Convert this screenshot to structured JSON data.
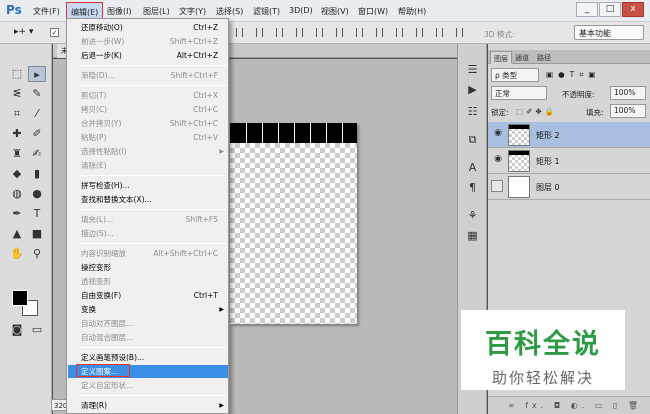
{
  "app": {
    "logo": "Ps",
    "menus": [
      "文件(F)",
      "编辑(E)",
      "图像(I)",
      "图层(L)",
      "文字(Y)",
      "选择(S)",
      "滤镜(T)",
      "3D(D)",
      "视图(V)",
      "窗口(W)",
      "帮助(H)"
    ],
    "window_buttons": [
      "_",
      "□",
      "x"
    ]
  },
  "options_bar": {
    "mode_3d_label": "3D 模式:",
    "workspace": "基本功能"
  },
  "document": {
    "tab_label": "未",
    "zoom": "320"
  },
  "edit_menu": {
    "items": [
      {
        "label": "还原移动(O)",
        "shortcut": "Ctrl+Z",
        "disabled": false
      },
      {
        "label": "前进一步(W)",
        "shortcut": "Shift+Ctrl+Z",
        "disabled": true
      },
      {
        "label": "后退一步(K)",
        "shortcut": "Alt+Ctrl+Z",
        "disabled": false
      },
      {
        "label": "渐隐(D)...",
        "shortcut": "Shift+Ctrl+F",
        "disabled": true
      },
      {
        "label": "剪切(T)",
        "shortcut": "Ctrl+X",
        "disabled": true
      },
      {
        "label": "拷贝(C)",
        "shortcut": "Ctrl+C",
        "disabled": true
      },
      {
        "label": "合并拷贝(Y)",
        "shortcut": "Shift+Ctrl+C",
        "disabled": true
      },
      {
        "label": "粘贴(P)",
        "shortcut": "Ctrl+V",
        "disabled": true
      },
      {
        "label": "选择性粘贴(I)",
        "shortcut": "",
        "disabled": true,
        "submenu": true
      },
      {
        "label": "清除(E)",
        "shortcut": "",
        "disabled": true
      },
      {
        "label": "拼写检查(H)...",
        "shortcut": "",
        "disabled": false
      },
      {
        "label": "查找和替换文本(X)...",
        "shortcut": "",
        "disabled": false
      },
      {
        "label": "填充(L)...",
        "shortcut": "Shift+F5",
        "disabled": true
      },
      {
        "label": "描边(S)...",
        "shortcut": "",
        "disabled": true
      },
      {
        "label": "内容识别缩放",
        "shortcut": "Alt+Shift+Ctrl+C",
        "disabled": true
      },
      {
        "label": "操控变形",
        "shortcut": "",
        "disabled": false
      },
      {
        "label": "透视变形",
        "shortcut": "",
        "disabled": true
      },
      {
        "label": "自由变换(F)",
        "shortcut": "Ctrl+T",
        "disabled": false
      },
      {
        "label": "变换",
        "shortcut": "",
        "disabled": false,
        "submenu": true
      },
      {
        "label": "自动对齐图层...",
        "shortcut": "",
        "disabled": true
      },
      {
        "label": "自动混合图层...",
        "shortcut": "",
        "disabled": true
      },
      {
        "label": "定义画笔预设(B)...",
        "shortcut": "",
        "disabled": false
      },
      {
        "label": "定义图案...",
        "shortcut": "",
        "disabled": false,
        "highlight": true
      },
      {
        "label": "定义自定形状...",
        "shortcut": "",
        "disabled": true
      },
      {
        "label": "清理(R)",
        "shortcut": "",
        "disabled": false,
        "submenu": true
      }
    ]
  },
  "layers_panel": {
    "tabs": [
      "图层",
      "通道",
      "路径"
    ],
    "filter_kind": "ρ 类型",
    "blend_mode": "正常",
    "opacity_label": "不透明度:",
    "opacity": "100%",
    "lock_label": "锁定:",
    "fill_label": "填充:",
    "fill": "100%",
    "layers": [
      {
        "name": "矩形 2",
        "selected": true,
        "visible": true
      },
      {
        "name": "矩形 1",
        "selected": false,
        "visible": true
      },
      {
        "name": "图层 0",
        "selected": false,
        "visible": false
      }
    ],
    "bottom_icons": "∞ fx. ◘ ◐. ▭ ▯ 🗑"
  },
  "watermark": {
    "title": "百科全说",
    "subtitle": "助你轻松解决"
  }
}
